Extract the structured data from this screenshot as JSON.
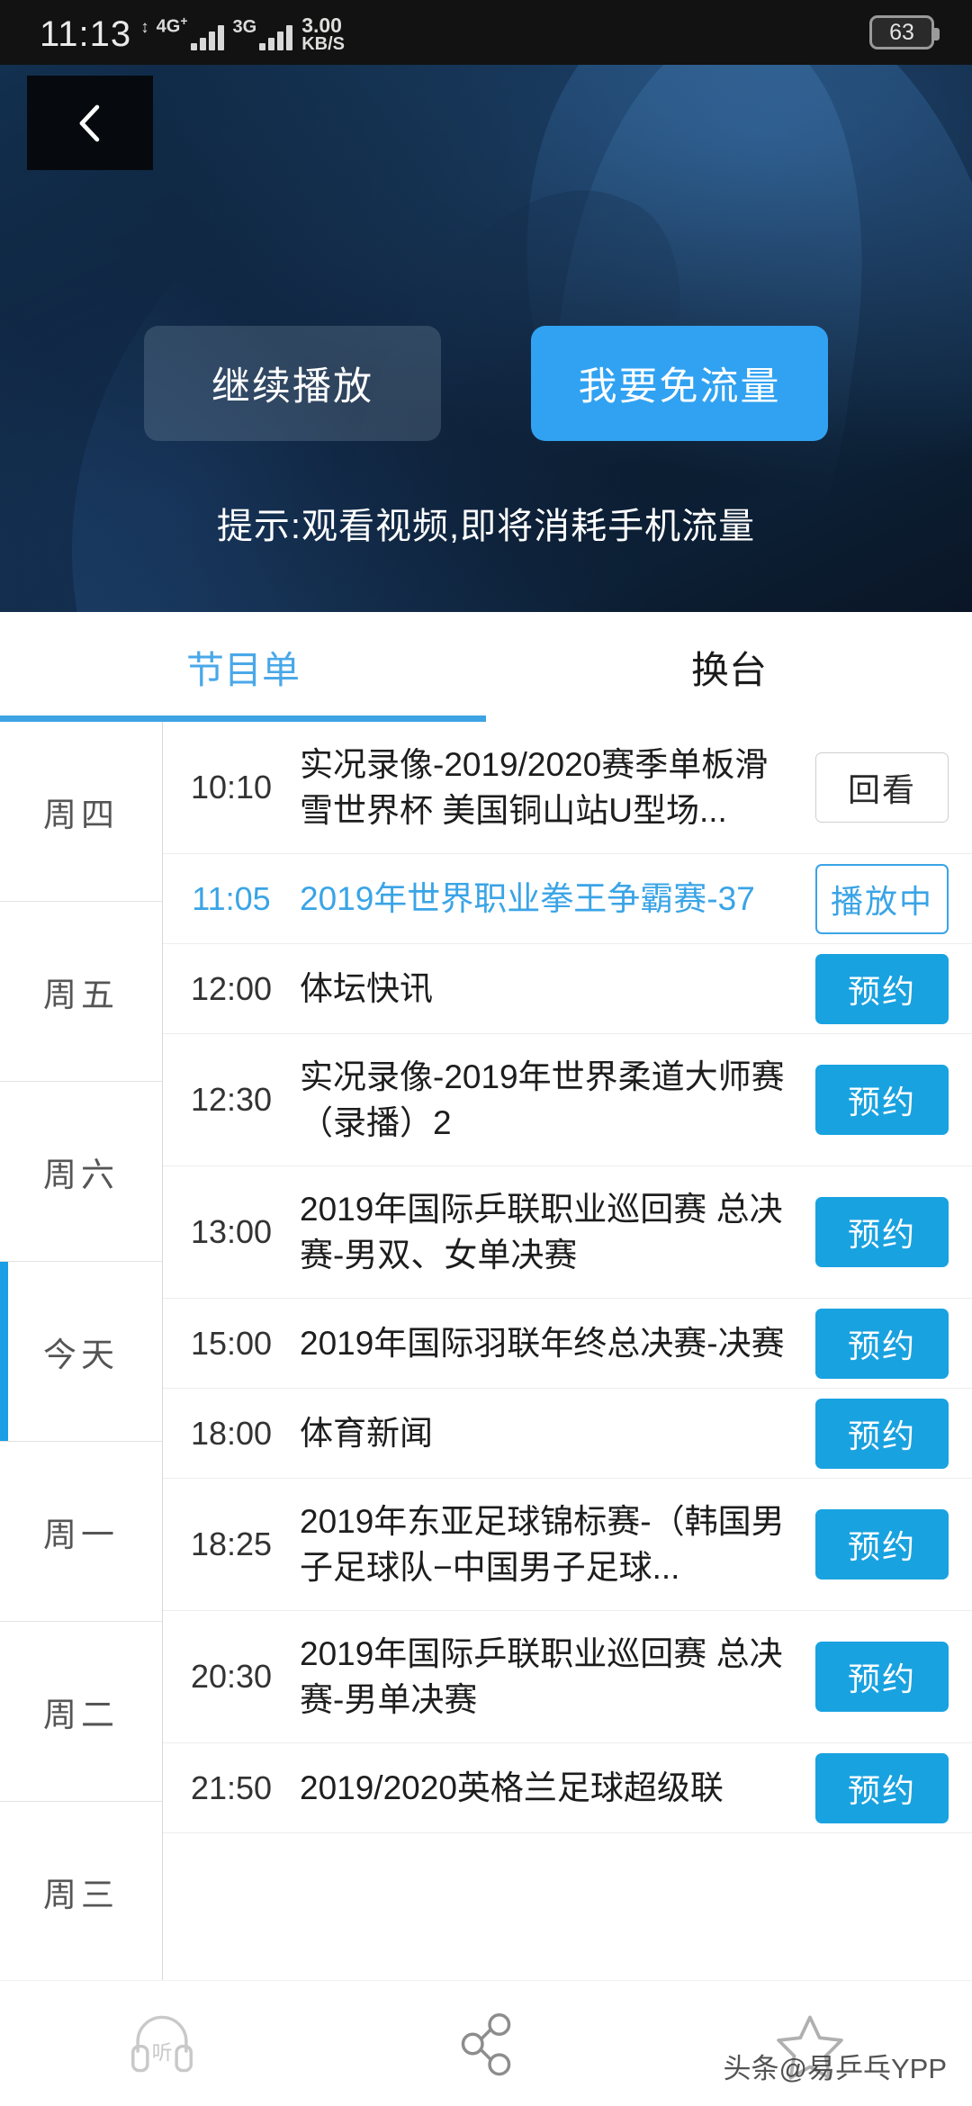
{
  "status_bar": {
    "time": "11:13",
    "network_primary": "4G",
    "network_primary_sup": "+",
    "network_secondary": "3G",
    "speed_value": "3.00",
    "speed_unit": "KB/S",
    "battery_percent": "63"
  },
  "player": {
    "back_icon": "chevron-left-icon",
    "continue_button": "继续播放",
    "free_data_button": "我要免流量",
    "hint": "提示:观看视频,即将消耗手机流量",
    "accent_color": "#31a2f2"
  },
  "tabs": [
    {
      "label": "节目单",
      "active": true
    },
    {
      "label": "换台",
      "active": false
    }
  ],
  "days": [
    {
      "label": "周四",
      "active": false
    },
    {
      "label": "周五",
      "active": false
    },
    {
      "label": "周六",
      "active": false
    },
    {
      "label": "今天",
      "active": true
    },
    {
      "label": "周一",
      "active": false
    },
    {
      "label": "周二",
      "active": false
    },
    {
      "label": "周三",
      "active": false
    }
  ],
  "programs": [
    {
      "time": "10:10",
      "title": "实况录像-2019/2020赛季单板滑雪世界杯 美国铜山站U型场...",
      "action": "回看",
      "state": "replay"
    },
    {
      "time": "11:05",
      "title": "2019年世界职业拳王争霸赛-37",
      "action": "播放中",
      "state": "playing"
    },
    {
      "time": "12:00",
      "title": "体坛快讯",
      "action": "预约",
      "state": "reserve"
    },
    {
      "time": "12:30",
      "title": "实况录像-2019年世界柔道大师赛（录播）2",
      "action": "预约",
      "state": "reserve"
    },
    {
      "time": "13:00",
      "title": "2019年国际乒联职业巡回赛 总决赛-男双、女单决赛",
      "action": "预约",
      "state": "reserve"
    },
    {
      "time": "15:00",
      "title": "2019年国际羽联年终总决赛-决赛",
      "action": "预约",
      "state": "reserve"
    },
    {
      "time": "18:00",
      "title": "体育新闻",
      "action": "预约",
      "state": "reserve"
    },
    {
      "time": "18:25",
      "title": "2019年东亚足球锦标赛-（韩国男子足球队−中国男子足球...",
      "action": "预约",
      "state": "reserve"
    },
    {
      "time": "20:30",
      "title": "2019年国际乒联职业巡回赛 总决赛-男单决赛",
      "action": "预约",
      "state": "reserve"
    },
    {
      "time": "21:50",
      "title": "2019/2020英格兰足球超级联",
      "action": "预约",
      "state": "reserve"
    }
  ],
  "bottom_bar": {
    "items": [
      {
        "icon": "headphone-listen-icon",
        "label": "听"
      },
      {
        "icon": "share-icon",
        "label": ""
      },
      {
        "icon": "star-favorite-icon",
        "label": ""
      }
    ]
  },
  "watermark": "头条@易乒乓YPP"
}
